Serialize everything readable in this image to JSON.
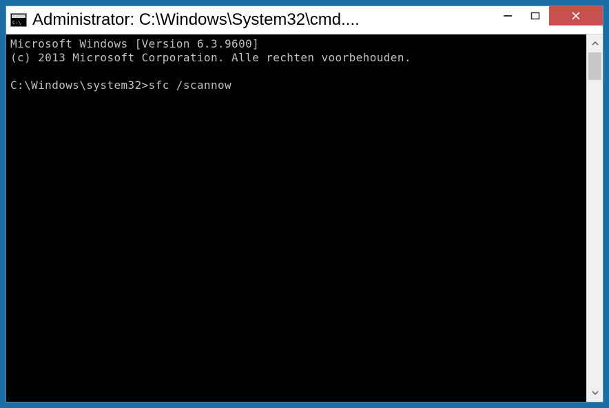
{
  "window": {
    "title": "Administrator: C:\\Windows\\System32\\cmd...."
  },
  "console": {
    "line1": "Microsoft Windows [Version 6.3.9600]",
    "line2": "(c) 2013 Microsoft Corporation. Alle rechten voorbehouden.",
    "blank": "",
    "prompt": "C:\\Windows\\system32>",
    "command": "sfc /scannow"
  }
}
